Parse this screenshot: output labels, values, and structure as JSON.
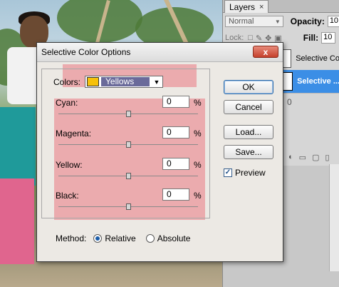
{
  "layers_panel": {
    "tab_label": "Layers",
    "close_glyph": "×",
    "blend_mode": "Normal",
    "opacity_label": "Opacity:",
    "opacity_value": "10",
    "lock_label": "Lock:",
    "fill_label": "Fill:",
    "fill_value": "10",
    "layers": [
      {
        "name": "Selective Co",
        "selected": false
      },
      {
        "name": "Selective ...",
        "selected": true
      }
    ],
    "zero_text": "0"
  },
  "dialog": {
    "title": "Selective Color Options",
    "close_glyph": "x",
    "colors_label": "Colors:",
    "colors_value": "Yellows",
    "colors_swatch": "#f6c10a",
    "sliders": [
      {
        "label": "Cyan:",
        "value": "0",
        "unit": "%",
        "level": 0.5
      },
      {
        "label": "Magenta:",
        "value": "0",
        "unit": "%",
        "level": 0.5
      },
      {
        "label": "Yellow:",
        "value": "0",
        "unit": "%",
        "level": 0.5
      },
      {
        "label": "Black:",
        "value": "0",
        "unit": "%",
        "level": 0.5
      }
    ],
    "buttons": {
      "ok": "OK",
      "cancel": "Cancel",
      "load": "Load...",
      "save": "Save..."
    },
    "preview_label": "Preview",
    "preview_checked": true,
    "method_label": "Method:",
    "method_options": [
      "Relative",
      "Absolute"
    ],
    "method_selected": "Relative"
  },
  "colors": {
    "highlight": "#eb7882",
    "selection_blue": "#3b8ee6",
    "close_red": "#c4402c"
  }
}
